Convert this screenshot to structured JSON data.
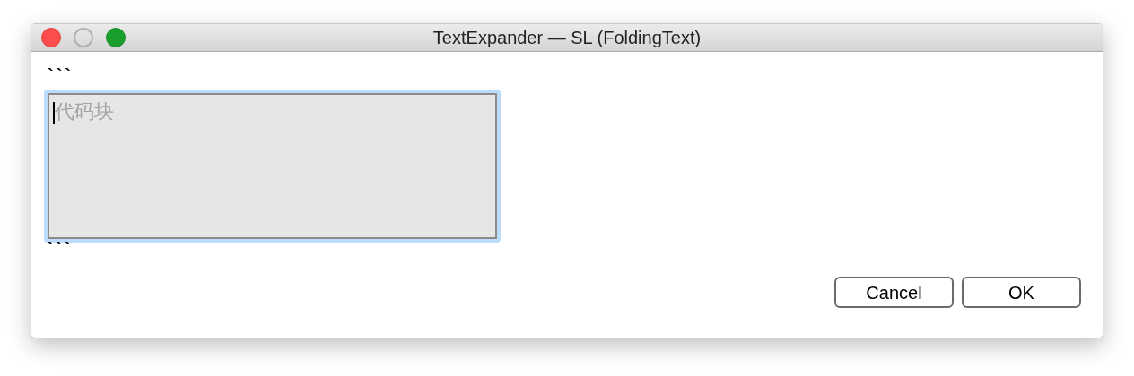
{
  "window": {
    "title": "TextExpander — SL (FoldingText)",
    "controls": [
      {
        "kind": "close",
        "disabled": false
      },
      {
        "kind": "minimize",
        "disabled": true
      },
      {
        "kind": "zoom",
        "disabled": false
      }
    ]
  },
  "prefix": "```",
  "field": {
    "placeholder": "代码块",
    "focused": true
  },
  "suffix": "```",
  "buttons": [
    "Cancel",
    "OK"
  ]
}
